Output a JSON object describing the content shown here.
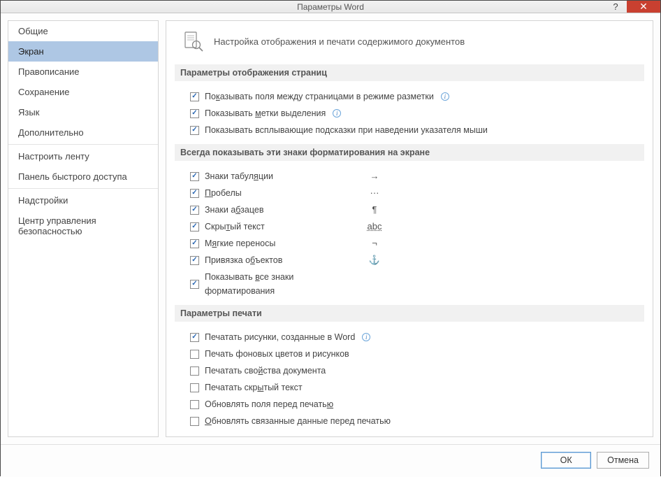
{
  "title": "Параметры Word",
  "sidebar": {
    "items": [
      {
        "label": "Общие"
      },
      {
        "label": "Экран",
        "selected": true
      },
      {
        "label": "Правописание"
      },
      {
        "label": "Сохранение"
      },
      {
        "label": "Язык"
      },
      {
        "label": "Дополнительно"
      },
      {
        "label": "Настроить ленту",
        "sep_before": true
      },
      {
        "label": "Панель быстрого доступа"
      },
      {
        "label": "Надстройки",
        "sep_before": true
      },
      {
        "label": "Центр управления безопасностью"
      }
    ]
  },
  "content": {
    "heading": "Настройка отображения и печати содержимого документов",
    "sections": {
      "page_display": {
        "title": "Параметры отображения страниц",
        "options": [
          {
            "label_html": "По<u>к</u>азывать поля между страницами в режиме разметки",
            "checked": true,
            "info": true
          },
          {
            "label_html": "Показывать <u>м</u>етки выделения",
            "checked": true,
            "info": true
          },
          {
            "label_html": "Показывать всплывающие подсказки при наведении указателя мыши",
            "checked": true
          }
        ]
      },
      "formatting": {
        "title": "Всегда показывать эти знаки форматирования на экране",
        "options": [
          {
            "label_html": "Знаки табул<u>я</u>ции",
            "checked": true,
            "symbol": "→"
          },
          {
            "label_html": "<u>П</u>робелы",
            "checked": true,
            "symbol": "···"
          },
          {
            "label_html": "Знаки а<u>б</u>зацев",
            "checked": true,
            "symbol": "¶"
          },
          {
            "label_html": "Скры<u>т</u>ый текст",
            "checked": true,
            "symbol_html": "<span class='hidden-dotted'>abc</span>"
          },
          {
            "label_html": "М<u>я</u>гкие переносы",
            "checked": true,
            "symbol": "¬"
          },
          {
            "label_html": "Привязка о<u>б</u>ъектов",
            "checked": true,
            "symbol": "⚓"
          },
          {
            "label_html": "Показывать <u>в</u>се знаки форматирования",
            "checked": true
          }
        ]
      },
      "printing": {
        "title": "Параметры печати",
        "options": [
          {
            "label_html": "Печатать рисунки, созданные в Word",
            "checked": true,
            "info": true
          },
          {
            "label_html": "Печать фоновых цветов и рисунков",
            "checked": false
          },
          {
            "label_html": "Печатать сво<u>й</u>ства документа",
            "checked": false
          },
          {
            "label_html": "Печатать скр<u>ы</u>тый текст",
            "checked": false
          },
          {
            "label_html": "Обновлять поля перед печать<u>ю</u>",
            "checked": false
          },
          {
            "label_html": "<u>О</u>бновлять связанные данные перед печатью",
            "checked": false
          }
        ]
      }
    }
  },
  "buttons": {
    "ok": "ОК",
    "cancel": "Отмена"
  },
  "titlebar": {
    "help": "?",
    "close": "✕"
  }
}
